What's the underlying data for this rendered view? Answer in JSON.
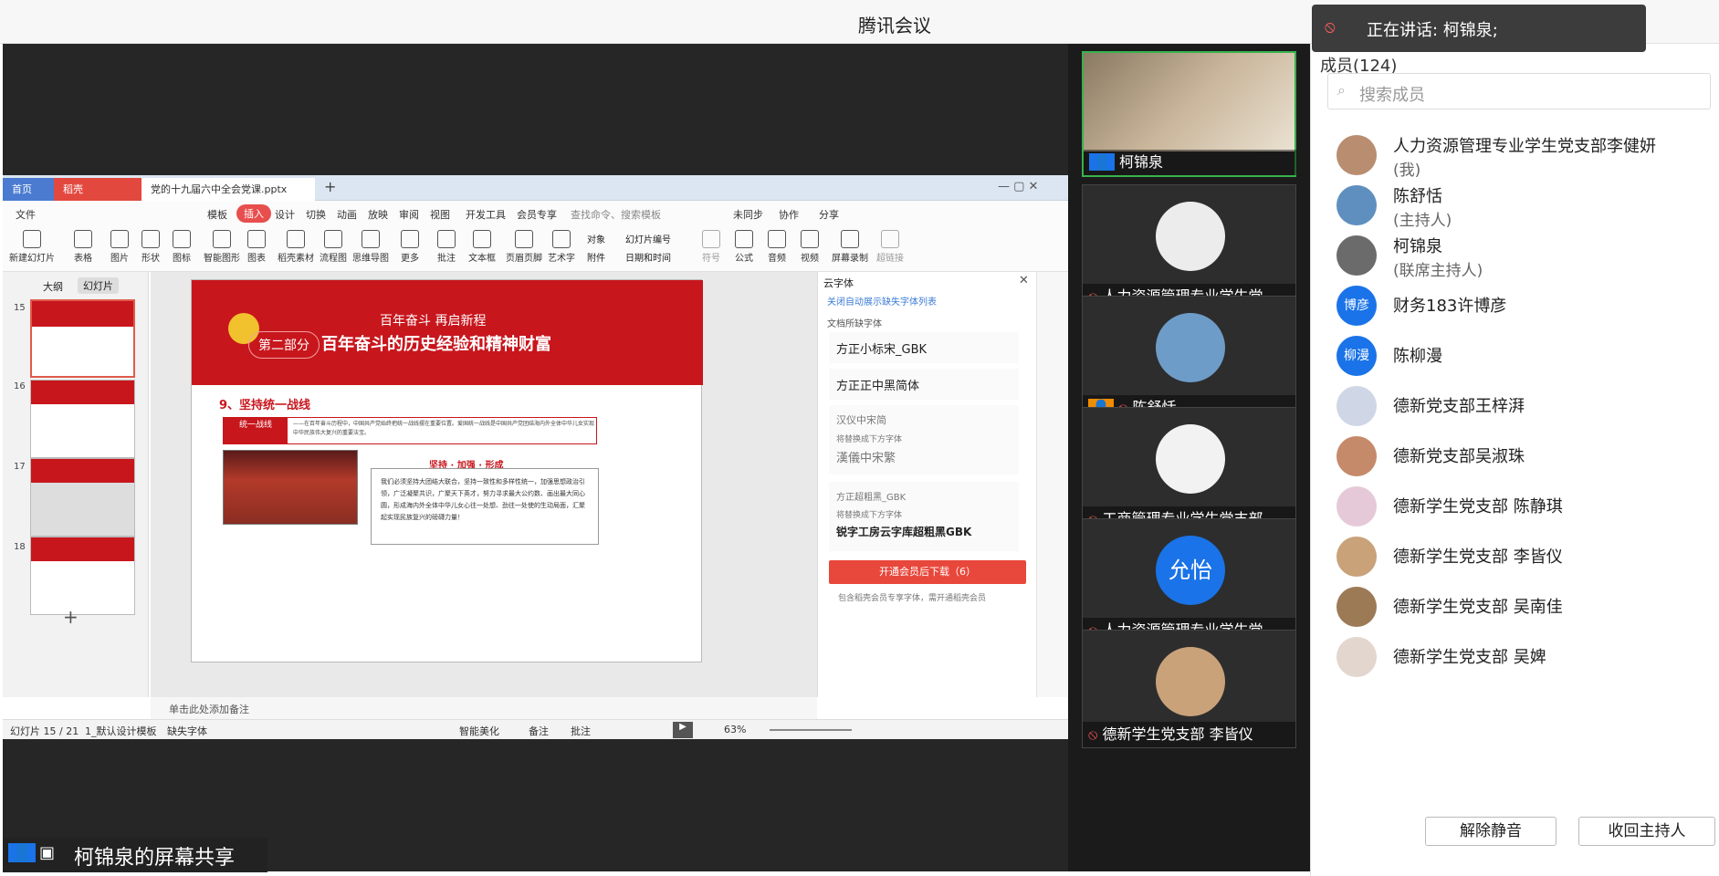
{
  "app": {
    "title": "腾讯会议"
  },
  "speaking": {
    "text": "正在讲话: 柯锦泉;"
  },
  "share": {
    "label": "柯锦泉的屏幕共享"
  },
  "wps": {
    "tabs": [
      "首页",
      "稻壳",
      "党的十九届六中全会党课.pptx"
    ],
    "menus": [
      "文件",
      "模板",
      "插入",
      "设计",
      "切换",
      "动画",
      "放映",
      "审阅",
      "视图",
      "开发工具",
      "会员专享"
    ],
    "search_placeholder": "查找命令、搜索模板",
    "menu_right": [
      "未同步",
      "协作",
      "分享"
    ],
    "ribbon": [
      "新建幻灯片",
      "表格",
      "图片",
      "形状",
      "图标",
      "智能图形",
      "图表",
      "稻壳素材",
      "流程图",
      "思维导图",
      "更多",
      "批注",
      "文本框",
      "页眉页脚",
      "艺术字",
      "对象",
      "幻灯片编号",
      "符号",
      "公式",
      "音频",
      "视频",
      "屏幕录制",
      "超链接"
    ],
    "ribbon_small": [
      "附件",
      "日期和时间"
    ],
    "panel_tabs": [
      "大纲",
      "幻灯片"
    ],
    "thumb_numbers": [
      "15",
      "16",
      "17",
      "18"
    ],
    "slide": {
      "kicker": "百年奋斗  再启新程",
      "part": "第二部分",
      "title": "百年奋斗的历史经验和精神财富",
      "section": "9、坚持统一战线",
      "box_label": "统一战线",
      "box_text": "——在百年奋斗历程中，中国共产党始终把统一战线摆在重要位置。爱国统一战线是中国共产党团结海内外全体中华儿女实现中华民族伟大复兴的重要法宝。",
      "sub_heading": "坚持 · 加强 · 形成",
      "body": "我们必须坚持大团结大联合，坚持一致性和多样性统一，加强思想政治引领，广泛凝聚共识，广聚天下英才，努力寻求最大公约数、画出最大同心圆，形成海内外全体中华儿女心往一处想、劲往一处使的生动局面，汇聚起实现民族复兴的磅礴力量！"
    },
    "font_panel": {
      "title": "云字体",
      "link": "关闭自动展示缺失字体列表",
      "missing_label": "文档所缺字体",
      "rows": [
        {
          "name": "方正小标宋_GBK",
          "sub": "",
          "alt": ""
        },
        {
          "name": "方正正中黑简体",
          "sub": "",
          "alt": ""
        },
        {
          "name": "汉仪中宋简",
          "sub": "将替换成下方字体",
          "alt": "漢儀中宋繁"
        },
        {
          "name": "方正超粗黑_GBK",
          "sub": "将替换成下方字体",
          "alt": "锐字工房云字库超粗黑GBK"
        }
      ],
      "download": "开通会员后下载（6）",
      "note": "包含稻壳会员专享字体，需开通稻壳会员"
    },
    "notes_placeholder": "单击此处添加备注",
    "status": {
      "slide": "幻灯片 15 / 21",
      "template": "1_默认设计模板",
      "missing": "缺失字体",
      "beautify": "智能美化",
      "note": "备注",
      "comment": "批注",
      "zoom": "63%"
    }
  },
  "videos": [
    {
      "name": "柯锦泉",
      "avatar_text": "",
      "color": "#c9b59a"
    },
    {
      "name": "人力资源管理专业学生党...",
      "avatar_text": "",
      "color": "#ececec"
    },
    {
      "name": "陈舒恬",
      "avatar_text": "",
      "color": "#6e9cc8"
    },
    {
      "name": "工商管理专业学生党支部...",
      "avatar_text": "",
      "color": "#f2f2f2"
    },
    {
      "name": "人力资源管理专业学生党...",
      "avatar_text": "允怡",
      "color": "#1a73e8"
    },
    {
      "name": "德新学生党支部 李皆仪",
      "avatar_text": "",
      "color": "#c9a27a"
    }
  ],
  "members": {
    "header": "成员(124)",
    "search_placeholder": "搜索成员",
    "list": [
      {
        "name": "人力资源管理专业学生党支部李健妍",
        "role": "(我)",
        "avatar_text": "",
        "color": "#b98d70"
      },
      {
        "name": "陈舒恬",
        "role": "(主持人)",
        "avatar_text": "",
        "color": "#5f8fbf"
      },
      {
        "name": "柯锦泉",
        "role": "(联席主持人)",
        "avatar_text": "",
        "color": "#6b6b6b"
      },
      {
        "name": "财务183许博彦",
        "role": "",
        "avatar_text": "博彦",
        "color": "#1a73e8"
      },
      {
        "name": "陈柳漫",
        "role": "",
        "avatar_text": "柳漫",
        "color": "#1a73e8"
      },
      {
        "name": "德新党支部王梓湃",
        "role": "",
        "avatar_text": "",
        "color": "#cfd6e6"
      },
      {
        "name": "德新党支部吴淑珠",
        "role": "",
        "avatar_text": "",
        "color": "#c58a6a"
      },
      {
        "name": "德新学生党支部 陈静琪",
        "role": "",
        "avatar_text": "",
        "color": "#e6c9d8"
      },
      {
        "name": "德新学生党支部 李皆仪",
        "role": "",
        "avatar_text": "",
        "color": "#c9a27a"
      },
      {
        "name": "德新学生党支部 吴南佳",
        "role": "",
        "avatar_text": "",
        "color": "#9c7a56"
      },
      {
        "name": "德新学生党支部 吴婢",
        "role": "",
        "avatar_text": "",
        "color": "#e3d6cf"
      }
    ],
    "unmute": "解除静音",
    "reclaim": "收回主持人"
  }
}
